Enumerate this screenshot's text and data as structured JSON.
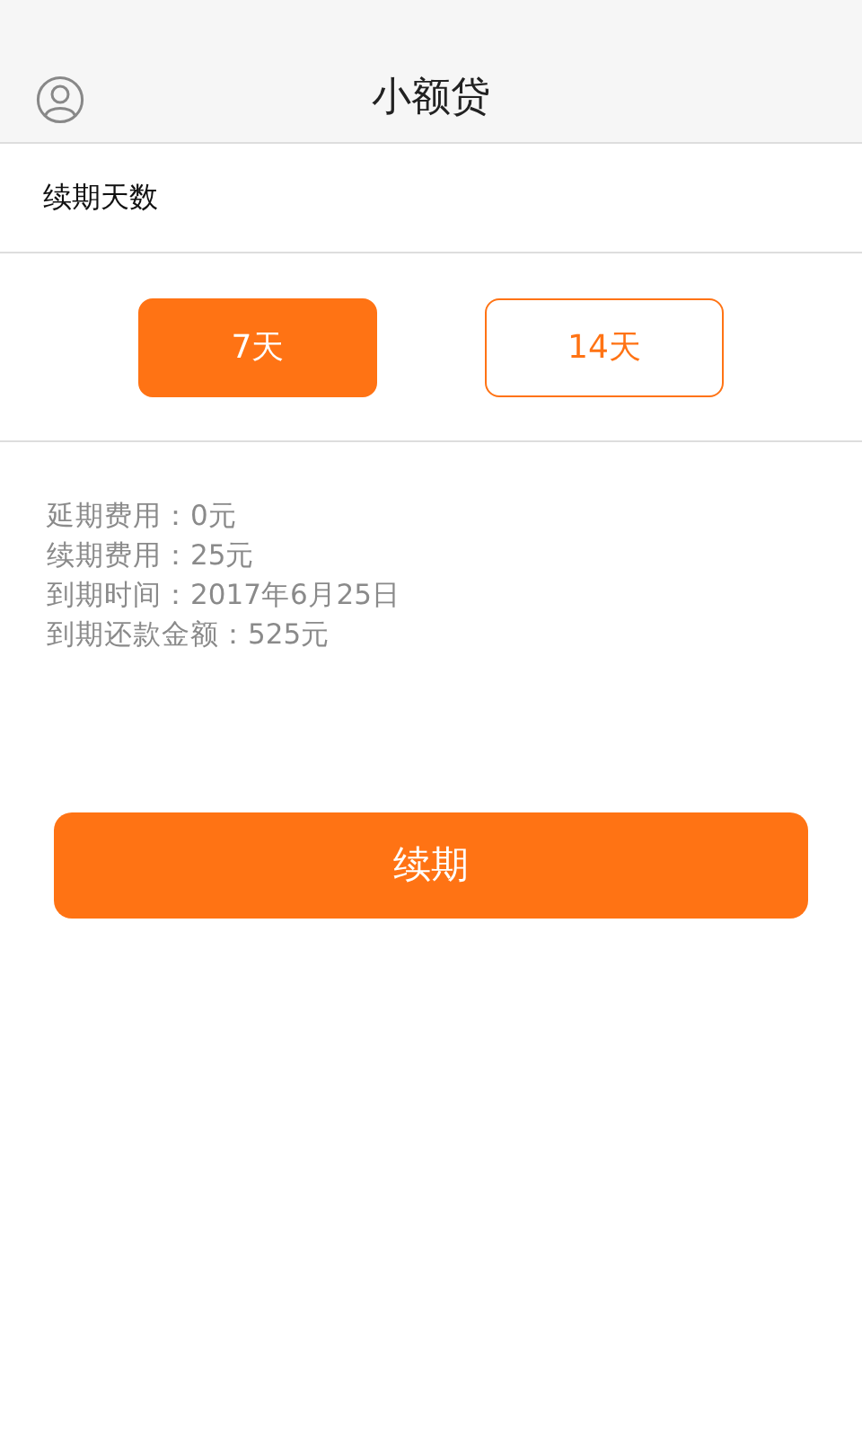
{
  "header": {
    "title": "小额贷"
  },
  "section": {
    "label": "续期天数"
  },
  "options": [
    {
      "label": "7天",
      "selected": true
    },
    {
      "label": "14天",
      "selected": false
    }
  ],
  "details": [
    "延期费用：0元",
    "续期费用：25元",
    "到期时间：2017年6月25日",
    "到期还款金额：525元"
  ],
  "action": {
    "label": "续期"
  }
}
